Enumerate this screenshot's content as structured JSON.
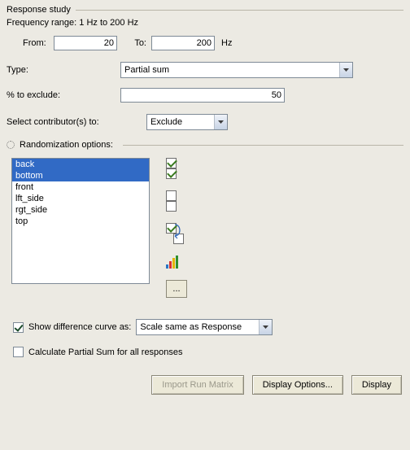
{
  "response_study": {
    "title": "Response study",
    "freq_range_label": "Frequency range: 1 Hz to 200 Hz",
    "from_label": "From:",
    "from_value": "20",
    "to_label": "To:",
    "to_value": "200",
    "unit": "Hz",
    "type_label": "Type:",
    "type_value": "Partial sum",
    "pct_exclude_label": "% to exclude:",
    "pct_exclude_value": "50",
    "select_contrib_label": "Select contributor(s) to:",
    "select_contrib_value": "Exclude"
  },
  "randomization": {
    "title": "Randomization options:",
    "items": [
      {
        "label": "back",
        "selected": true
      },
      {
        "label": "bottom",
        "selected": true
      },
      {
        "label": "front",
        "selected": false
      },
      {
        "label": "lft_side",
        "selected": false
      },
      {
        "label": "rgt_side",
        "selected": false
      },
      {
        "label": "top",
        "selected": false
      }
    ],
    "more_btn": "..."
  },
  "options": {
    "show_diff_curve_label": "Show difference curve as:",
    "show_diff_curve_checked": true,
    "show_diff_curve_value": "Scale same as Response",
    "calc_partial_sum_label": "Calculate Partial Sum for all responses",
    "calc_partial_sum_checked": false
  },
  "buttons": {
    "import_run_matrix": "Import Run Matrix",
    "display_options": "Display Options...",
    "display": "Display"
  }
}
